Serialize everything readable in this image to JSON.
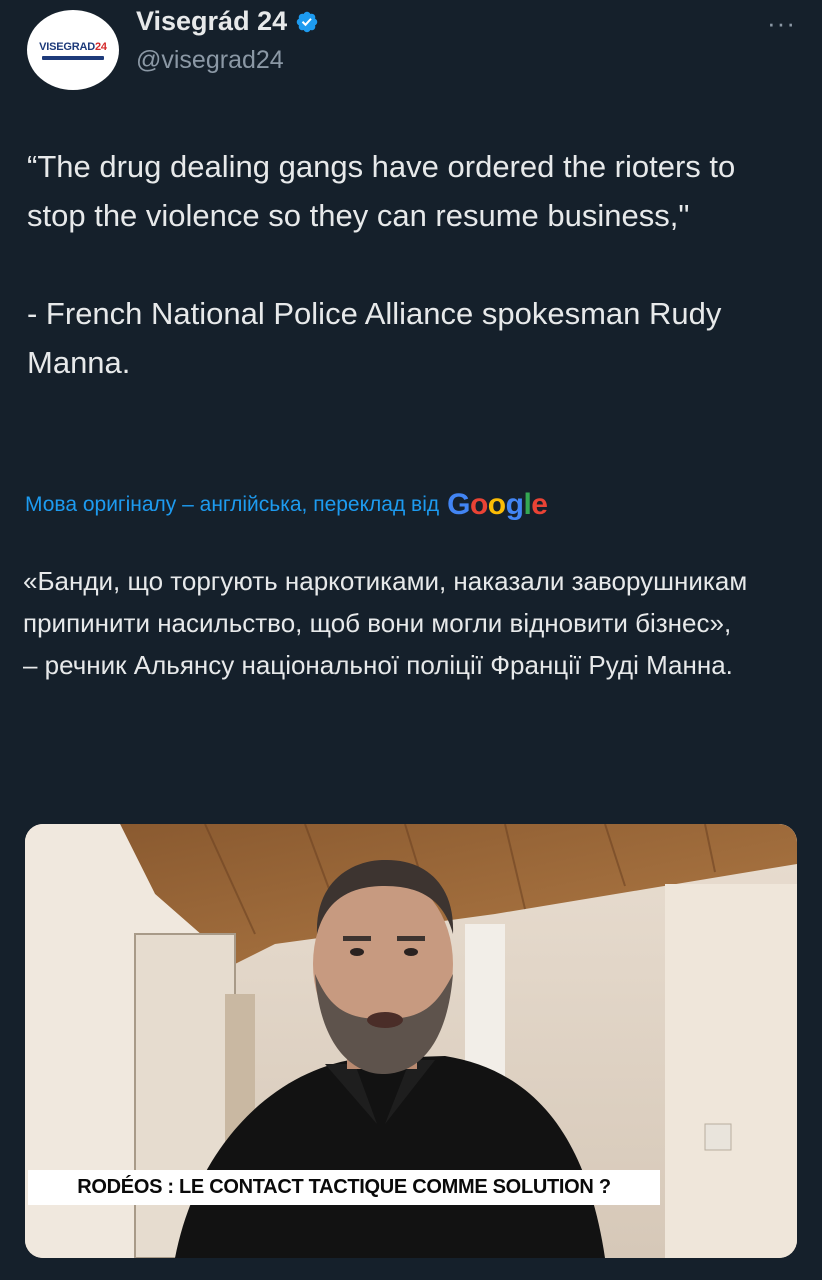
{
  "account": {
    "display_name": "Visegrád 24",
    "handle": "@visegrad24",
    "avatar_text_main": "VISEGRAD",
    "avatar_text_num": "24",
    "more_label": "···",
    "verified_icon": "verified-badge-icon",
    "accent": "#1d9bf0"
  },
  "tweet": {
    "text": "“The drug dealing gangs have ordered the rioters to stop the violence so they can resume business,\"\n\n- French National Police Alliance spokesman Rudy Manna.",
    "translation_note": "Мова оригіналу – англійська, переклад від",
    "translation_provider": [
      "G",
      "o",
      "o",
      "g",
      "l",
      "e"
    ],
    "translated_text": "«Банди, що торгують наркотиками, наказали заворушникам припинити насильство, щоб вони могли відновити бізнес»,\n– речник Альянсу національної поліції Франції Руді Манна."
  },
  "media": {
    "banner_text": "RODÉOS : LE CONTACT TACTIQUE COMME SOLUTION ?"
  },
  "colors": {
    "background": "#15202b",
    "text": "#e7e9ea",
    "secondary": "#8b98a5",
    "link": "#1d9bf0"
  }
}
